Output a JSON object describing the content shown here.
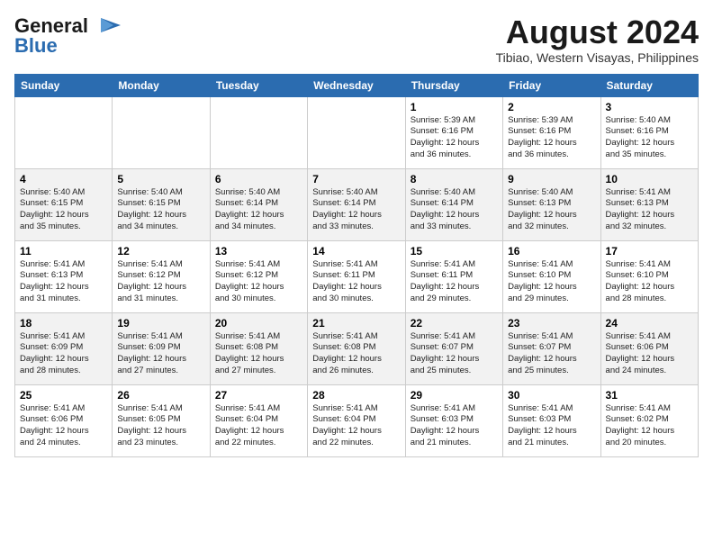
{
  "header": {
    "logo_line1": "General",
    "logo_line2": "Blue",
    "month": "August 2024",
    "location": "Tibiao, Western Visayas, Philippines"
  },
  "days_of_week": [
    "Sunday",
    "Monday",
    "Tuesday",
    "Wednesday",
    "Thursday",
    "Friday",
    "Saturday"
  ],
  "weeks": [
    [
      {
        "day": "",
        "info": ""
      },
      {
        "day": "",
        "info": ""
      },
      {
        "day": "",
        "info": ""
      },
      {
        "day": "",
        "info": ""
      },
      {
        "day": "1",
        "info": "Sunrise: 5:39 AM\nSunset: 6:16 PM\nDaylight: 12 hours\nand 36 minutes."
      },
      {
        "day": "2",
        "info": "Sunrise: 5:39 AM\nSunset: 6:16 PM\nDaylight: 12 hours\nand 36 minutes."
      },
      {
        "day": "3",
        "info": "Sunrise: 5:40 AM\nSunset: 6:16 PM\nDaylight: 12 hours\nand 35 minutes."
      }
    ],
    [
      {
        "day": "4",
        "info": "Sunrise: 5:40 AM\nSunset: 6:15 PM\nDaylight: 12 hours\nand 35 minutes."
      },
      {
        "day": "5",
        "info": "Sunrise: 5:40 AM\nSunset: 6:15 PM\nDaylight: 12 hours\nand 34 minutes."
      },
      {
        "day": "6",
        "info": "Sunrise: 5:40 AM\nSunset: 6:14 PM\nDaylight: 12 hours\nand 34 minutes."
      },
      {
        "day": "7",
        "info": "Sunrise: 5:40 AM\nSunset: 6:14 PM\nDaylight: 12 hours\nand 33 minutes."
      },
      {
        "day": "8",
        "info": "Sunrise: 5:40 AM\nSunset: 6:14 PM\nDaylight: 12 hours\nand 33 minutes."
      },
      {
        "day": "9",
        "info": "Sunrise: 5:40 AM\nSunset: 6:13 PM\nDaylight: 12 hours\nand 32 minutes."
      },
      {
        "day": "10",
        "info": "Sunrise: 5:41 AM\nSunset: 6:13 PM\nDaylight: 12 hours\nand 32 minutes."
      }
    ],
    [
      {
        "day": "11",
        "info": "Sunrise: 5:41 AM\nSunset: 6:13 PM\nDaylight: 12 hours\nand 31 minutes."
      },
      {
        "day": "12",
        "info": "Sunrise: 5:41 AM\nSunset: 6:12 PM\nDaylight: 12 hours\nand 31 minutes."
      },
      {
        "day": "13",
        "info": "Sunrise: 5:41 AM\nSunset: 6:12 PM\nDaylight: 12 hours\nand 30 minutes."
      },
      {
        "day": "14",
        "info": "Sunrise: 5:41 AM\nSunset: 6:11 PM\nDaylight: 12 hours\nand 30 minutes."
      },
      {
        "day": "15",
        "info": "Sunrise: 5:41 AM\nSunset: 6:11 PM\nDaylight: 12 hours\nand 29 minutes."
      },
      {
        "day": "16",
        "info": "Sunrise: 5:41 AM\nSunset: 6:10 PM\nDaylight: 12 hours\nand 29 minutes."
      },
      {
        "day": "17",
        "info": "Sunrise: 5:41 AM\nSunset: 6:10 PM\nDaylight: 12 hours\nand 28 minutes."
      }
    ],
    [
      {
        "day": "18",
        "info": "Sunrise: 5:41 AM\nSunset: 6:09 PM\nDaylight: 12 hours\nand 28 minutes."
      },
      {
        "day": "19",
        "info": "Sunrise: 5:41 AM\nSunset: 6:09 PM\nDaylight: 12 hours\nand 27 minutes."
      },
      {
        "day": "20",
        "info": "Sunrise: 5:41 AM\nSunset: 6:08 PM\nDaylight: 12 hours\nand 27 minutes."
      },
      {
        "day": "21",
        "info": "Sunrise: 5:41 AM\nSunset: 6:08 PM\nDaylight: 12 hours\nand 26 minutes."
      },
      {
        "day": "22",
        "info": "Sunrise: 5:41 AM\nSunset: 6:07 PM\nDaylight: 12 hours\nand 25 minutes."
      },
      {
        "day": "23",
        "info": "Sunrise: 5:41 AM\nSunset: 6:07 PM\nDaylight: 12 hours\nand 25 minutes."
      },
      {
        "day": "24",
        "info": "Sunrise: 5:41 AM\nSunset: 6:06 PM\nDaylight: 12 hours\nand 24 minutes."
      }
    ],
    [
      {
        "day": "25",
        "info": "Sunrise: 5:41 AM\nSunset: 6:06 PM\nDaylight: 12 hours\nand 24 minutes."
      },
      {
        "day": "26",
        "info": "Sunrise: 5:41 AM\nSunset: 6:05 PM\nDaylight: 12 hours\nand 23 minutes."
      },
      {
        "day": "27",
        "info": "Sunrise: 5:41 AM\nSunset: 6:04 PM\nDaylight: 12 hours\nand 22 minutes."
      },
      {
        "day": "28",
        "info": "Sunrise: 5:41 AM\nSunset: 6:04 PM\nDaylight: 12 hours\nand 22 minutes."
      },
      {
        "day": "29",
        "info": "Sunrise: 5:41 AM\nSunset: 6:03 PM\nDaylight: 12 hours\nand 21 minutes."
      },
      {
        "day": "30",
        "info": "Sunrise: 5:41 AM\nSunset: 6:03 PM\nDaylight: 12 hours\nand 21 minutes."
      },
      {
        "day": "31",
        "info": "Sunrise: 5:41 AM\nSunset: 6:02 PM\nDaylight: 12 hours\nand 20 minutes."
      }
    ]
  ]
}
